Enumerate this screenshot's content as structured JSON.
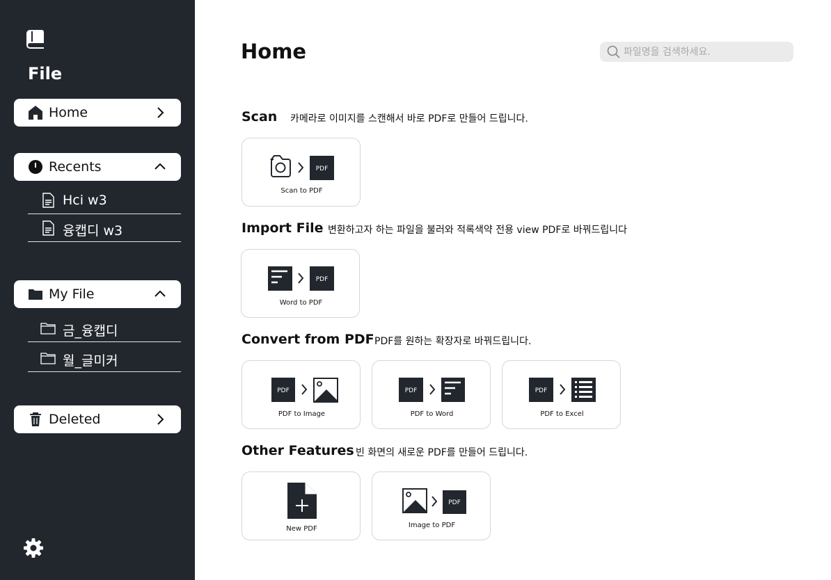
{
  "sidebar": {
    "app_title": "File",
    "home": {
      "label": "Home"
    },
    "recents": {
      "label": "Recents",
      "items": [
        "Hci w3",
        "융캡디 w3"
      ]
    },
    "my_file": {
      "label": "My File",
      "items": [
        "금_융캡디",
        "월_글미커"
      ]
    },
    "deleted": {
      "label": "Deleted"
    }
  },
  "main": {
    "title": "Home",
    "search": {
      "placeholder": "파일명을 검색하세요."
    },
    "sections": [
      {
        "title": "Scan",
        "description": "카메라로 이미지를 스캔해서 바로 PDF로 만들어 드립니다.",
        "cards": [
          "Scan to PDF"
        ]
      },
      {
        "title": "Import File",
        "description": "변환하고자 하는 파일을 불러와 적록색약 전용 view PDF로 바꿔드립니다",
        "cards": [
          "Word to PDF"
        ]
      },
      {
        "title": "Convert from PDF",
        "description": "PDF를 원하는 확장자로 바꿔드립니다.",
        "cards": [
          "PDF to Image",
          "PDF to Word",
          "PDF to Excel"
        ]
      },
      {
        "title": "Other Features",
        "description": "빈 화면의 새로운 PDF를 만들어 드립니다.",
        "cards": [
          "New PDF",
          "Image to PDF"
        ]
      }
    ],
    "pdf_badge": "PDF"
  },
  "colors": {
    "sidebar_bg": "#22272e",
    "accent_dark": "#22272e",
    "search_bg": "#ebebeb",
    "card_border": "#d6d6d6"
  },
  "icons": [
    "book-icon",
    "home-icon",
    "clock-icon",
    "folder-icon",
    "trash-icon",
    "document-icon",
    "chevron-right-icon",
    "chevron-up-icon",
    "search-icon",
    "gear-icon",
    "camera-icon",
    "word-doc-icon",
    "image-icon",
    "excel-list-icon",
    "new-file-icon"
  ]
}
